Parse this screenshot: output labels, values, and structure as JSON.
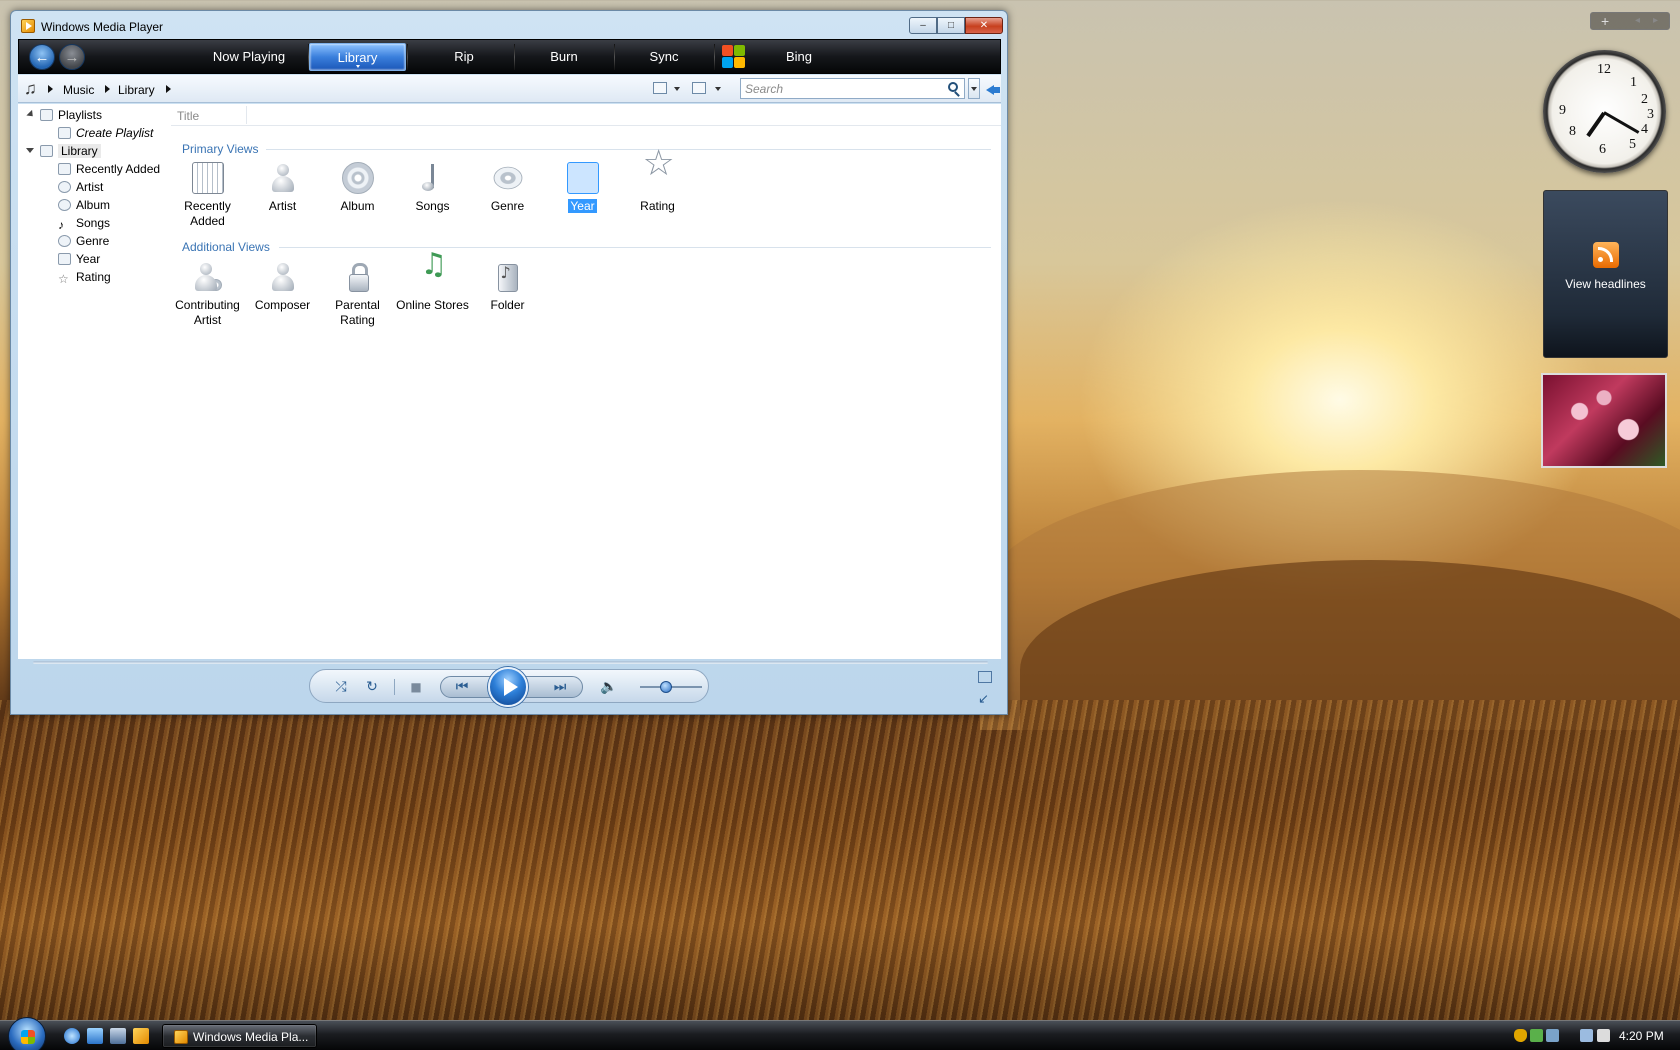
{
  "window": {
    "title": "Windows Media Player",
    "minimize": "–",
    "maximize": "□",
    "close": "✕"
  },
  "nav": {
    "back_icon": "←",
    "forward_icon": "→",
    "tabs": [
      {
        "label": "Now Playing",
        "active": false
      },
      {
        "label": "Library",
        "active": true
      },
      {
        "label": "Rip",
        "active": false
      },
      {
        "label": "Burn",
        "active": false
      },
      {
        "label": "Sync",
        "active": false
      },
      {
        "label": "Bing",
        "active": false
      }
    ]
  },
  "address": {
    "crumbs": [
      "Music",
      "Library"
    ],
    "search_placeholder": "Search"
  },
  "tree": {
    "playlists": "Playlists",
    "create_playlist": "Create Playlist",
    "library": "Library",
    "items": [
      "Recently Added",
      "Artist",
      "Album",
      "Songs",
      "Genre",
      "Year",
      "Rating"
    ]
  },
  "main": {
    "column_title": "Title",
    "primary_title": "Primary Views",
    "primary": [
      {
        "label": "Recently Added",
        "icon": "calendar-icon"
      },
      {
        "label": "Artist",
        "icon": "artist-icon"
      },
      {
        "label": "Album",
        "icon": "album-icon"
      },
      {
        "label": "Songs",
        "icon": "music-note-icon"
      },
      {
        "label": "Genre",
        "icon": "genre-icon"
      },
      {
        "label": "Year",
        "icon": "year-calendar-icon",
        "selected": true
      },
      {
        "label": "Rating",
        "icon": "star-icon"
      }
    ],
    "additional_title": "Additional Views",
    "additional": [
      {
        "label": "Contributing Artist",
        "icon": "contributing-artist-icon"
      },
      {
        "label": "Composer",
        "icon": "composer-icon"
      },
      {
        "label": "Parental Rating",
        "icon": "lock-icon"
      },
      {
        "label": "Online Stores",
        "icon": "online-stores-icon"
      },
      {
        "label": "Folder",
        "icon": "folder-icon"
      }
    ]
  },
  "player": {
    "shuffle": "⤮",
    "repeat": "↻",
    "stop": "■",
    "prev": "⏮",
    "next": "⏭",
    "volume": "🔈"
  },
  "sidebar": {
    "add_gadget": "+",
    "feed_text": "View headlines"
  },
  "taskbar": {
    "task_label": "Windows Media Pla...",
    "time": "4:20 PM"
  }
}
